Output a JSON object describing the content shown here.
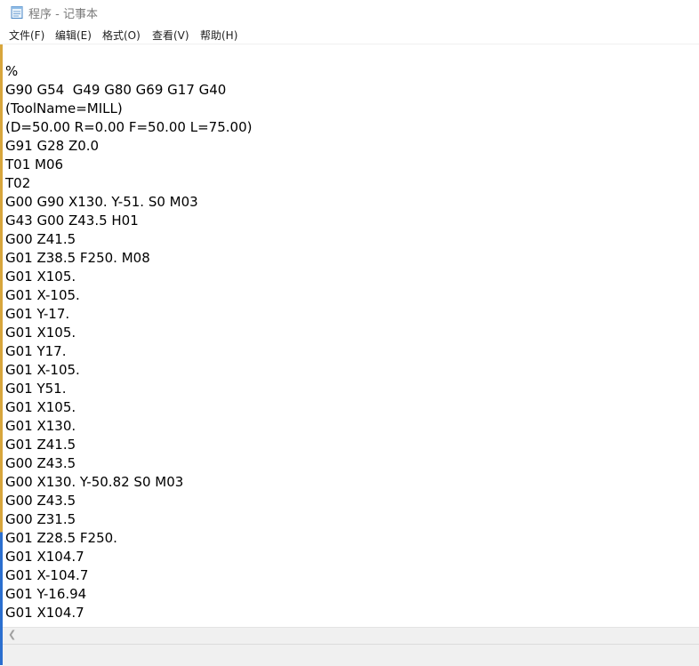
{
  "window": {
    "title": "程序 - 记事本"
  },
  "menu": {
    "file": "文件(F)",
    "edit": "编辑(E)",
    "format": "格式(O)",
    "view": "查看(V)",
    "help": "帮助(H)"
  },
  "editor": {
    "lines": [
      "%",
      "G90 G54  G49 G80 G69 G17 G40",
      "(ToolName=MILL)",
      "(D=50.00 R=0.00 F=50.00 L=75.00)",
      "G91 G28 Z0.0",
      "T01 M06",
      "T02",
      "G00 G90 X130. Y-51. S0 M03",
      "G43 G00 Z43.5 H01",
      "G00 Z41.5",
      "G01 Z38.5 F250. M08",
      "G01 X105.",
      "G01 X-105.",
      "G01 Y-17.",
      "G01 X105.",
      "G01 Y17.",
      "G01 X-105.",
      "G01 Y51.",
      "G01 X105.",
      "G01 X130.",
      "G01 Z41.5",
      "G00 Z43.5",
      "G00 X130. Y-50.82 S0 M03",
      "G00 Z43.5",
      "G00 Z31.5",
      "G01 Z28.5 F250.",
      "G01 X104.7",
      "G01 X-104.7",
      "G01 Y-16.94",
      "G01 X104.7"
    ]
  },
  "icons": {
    "app": "notepad-icon",
    "scroll_left": "chevron-left-icon"
  }
}
